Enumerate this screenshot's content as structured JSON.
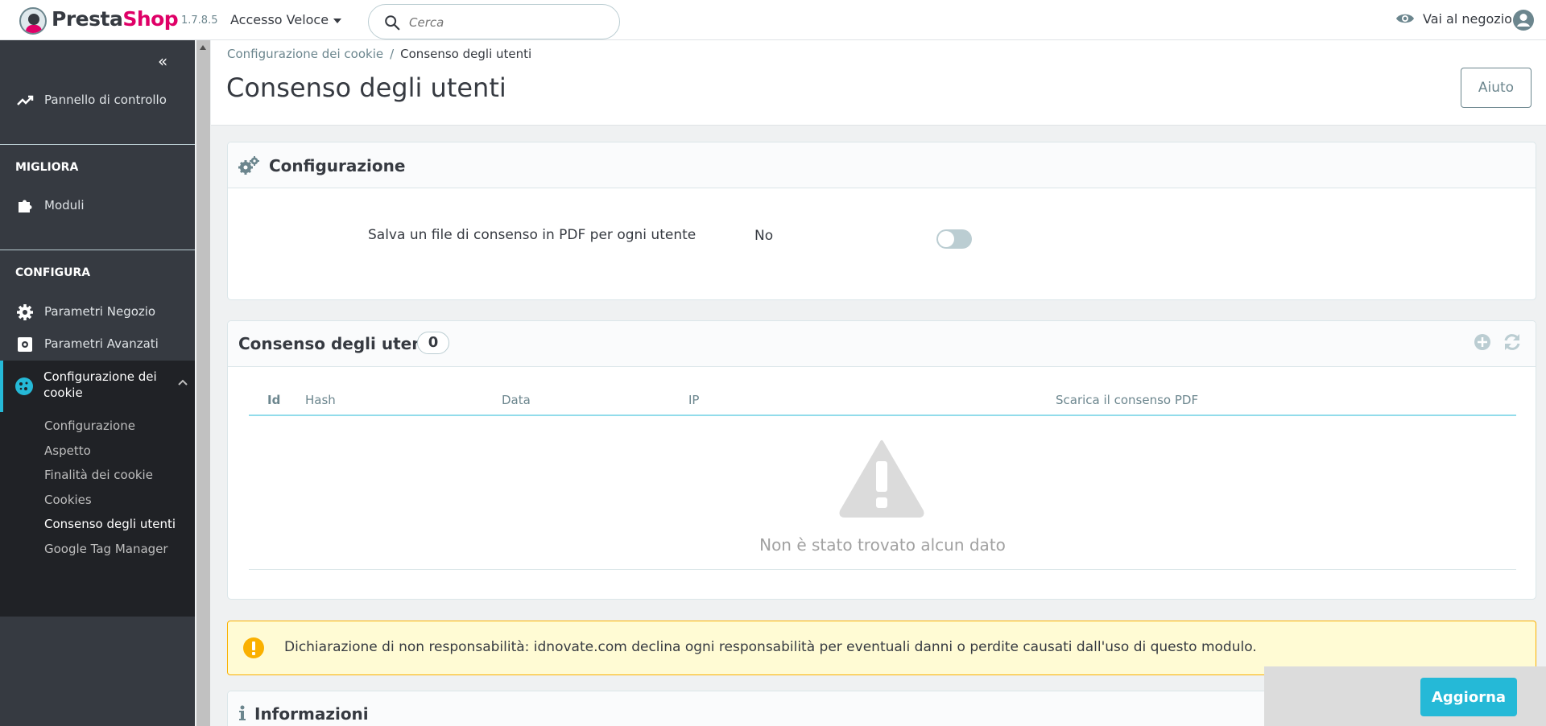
{
  "header": {
    "brand_pre": "Presta",
    "brand_post": "Shop",
    "version": "1.7.8.5",
    "quick_access": "Accesso Veloce",
    "search_placeholder": "Cerca",
    "shop_link": "Vai al negozio"
  },
  "sidebar": {
    "dashboard": "Pannello di controllo",
    "section_improve": "MIGLIORA",
    "modules": "Moduli",
    "section_configure": "CONFIGURA",
    "shop_params": "Parametri Negozio",
    "adv_params": "Parametri Avanzati",
    "active": "Configurazione dei cookie",
    "submenu": [
      "Configurazione",
      "Aspetto",
      "Finalità dei cookie",
      "Cookies",
      "Consenso degli utenti",
      "Google Tag Manager"
    ]
  },
  "page": {
    "breadcrumb_parent": "Configurazione dei cookie",
    "breadcrumb_sep": "/",
    "breadcrumb_current": "Consenso degli utenti",
    "title": "Consenso degli utenti",
    "help": "Aiuto"
  },
  "config_card": {
    "title": "Configurazione",
    "field_label": "Salva un file di consenso in PDF per ogni utente",
    "toggle_value": "No"
  },
  "consent_card": {
    "title": "Consenso degli utenti",
    "count": "0",
    "columns": [
      "Id",
      "Hash",
      "Data",
      "IP",
      "Scarica il consenso PDF"
    ],
    "empty": "Non è stato trovato alcun dato"
  },
  "alert": {
    "text": "Dichiarazione di non responsabilità: idnovate.com declina ogni responsabilità per eventuali danni o perdite causati dall'uso di questo modulo."
  },
  "info_card": {
    "title": "Informazioni"
  },
  "update_button": "Aggiorna",
  "colors": {
    "accent": "#25b9d7",
    "brand": "#df0067",
    "sidebar": "#363a41",
    "warning": "#fab000"
  }
}
